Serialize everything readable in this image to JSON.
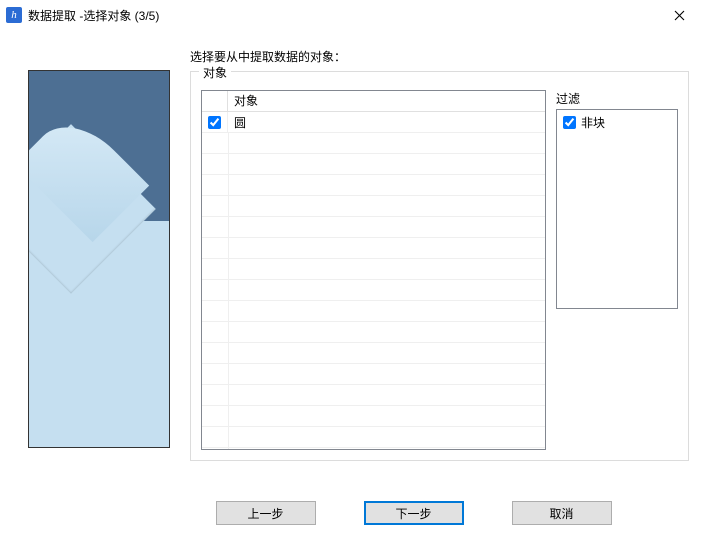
{
  "window": {
    "title": "数据提取 -选择对象 (3/5)",
    "icon_glyph": "h"
  },
  "instruction": "选择要从中提取数据的对象：",
  "objects_group": {
    "label": "对象",
    "column_header": "对象",
    "rows": [
      {
        "label": "圆",
        "checked": true
      }
    ]
  },
  "filter": {
    "label": "过滤",
    "items": [
      {
        "label": "非块",
        "checked": true
      }
    ]
  },
  "buttons": {
    "back": "上一步",
    "next": "下一步",
    "cancel": "取消"
  }
}
